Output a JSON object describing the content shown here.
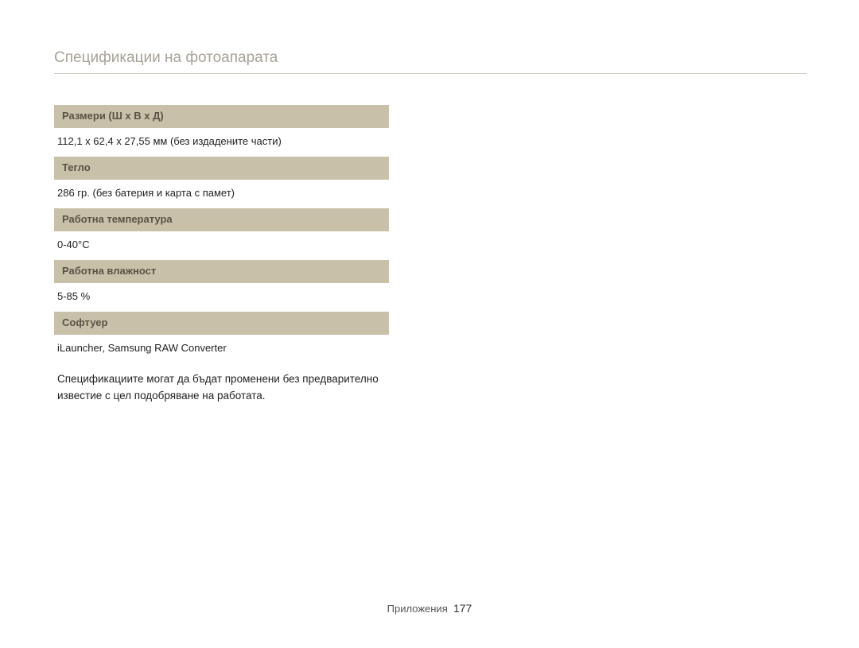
{
  "page": {
    "title": "Спецификации на фотоапарата"
  },
  "specs": {
    "dimensions": {
      "label": "Размери (Ш x В x Д)",
      "value": "112,1 x 62,4 x 27,55 мм (без издадените части)"
    },
    "weight": {
      "label": "Тегло",
      "value": "286 гр. (без батерия и карта с памет)"
    },
    "opTemp": {
      "label": "Работна температура",
      "value": "0-40°C"
    },
    "opHumidity": {
      "label": "Работна влажност",
      "value": "5-85 %"
    },
    "software": {
      "label": "Софтуер",
      "value": "iLauncher, Samsung RAW Converter"
    }
  },
  "note": "Спецификациите могат да бъдат променени без предварително известие с цел подобряване на работата.",
  "footer": {
    "section": "Приложения",
    "pageNumber": "177"
  }
}
